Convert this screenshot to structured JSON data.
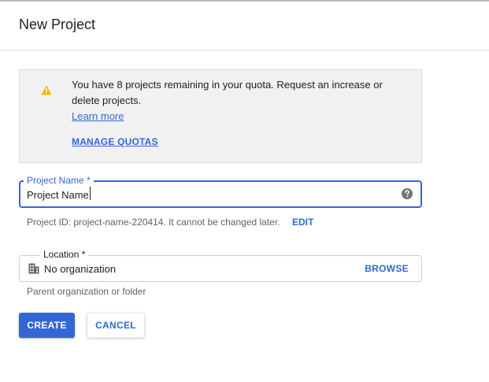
{
  "dialog": {
    "title": "New Project"
  },
  "quota_notice": {
    "icon": "warning-icon",
    "icon_color": "#f4b400",
    "message": "You have 8 projects remaining in your quota. Request an increase or delete projects.",
    "learn_more_label": "Learn more",
    "manage_quotas_label": "MANAGE QUOTAS"
  },
  "project_name": {
    "label": "Project Name  *",
    "value": "Project Name",
    "help_icon": "help-circle-icon"
  },
  "project_id": {
    "text": "Project ID: project-name-220414. It cannot be changed later.",
    "edit_label": "EDIT"
  },
  "location": {
    "label": "Location *",
    "icon": "organization-building-icon",
    "value": "No organization",
    "browse_label": "BROWSE",
    "helper": "Parent organization or folder"
  },
  "actions": {
    "create_label": "CREATE",
    "cancel_label": "CANCEL"
  },
  "colors": {
    "accent": "#3367d6",
    "warning": "#f4b400",
    "notice_background": "#f1f1f1"
  }
}
